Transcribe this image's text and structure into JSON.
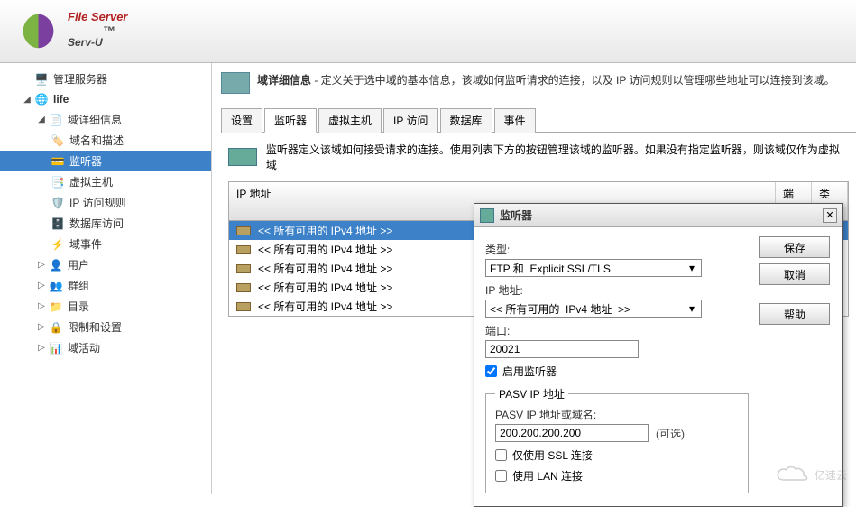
{
  "brand": {
    "top": "File Server",
    "name": "Serv-U",
    "trademark": "™"
  },
  "sidebar": {
    "manage_server": "管理服务器",
    "domain": "life",
    "detail_group": "域详细信息",
    "items": {
      "domain_desc": "域名和描述",
      "listener": "监听器",
      "vhost": "虚拟主机",
      "ip_rules": "IP 访问规则",
      "db_access": "数据库访问",
      "events": "域事件"
    },
    "user": "用户",
    "group": "群组",
    "directory": "目录",
    "restrict": "限制和设置",
    "activity": "域活动"
  },
  "main": {
    "desc_title": "域详细信息",
    "desc_body": " - 定义关于选中域的基本信息，该域如何监听请求的连接，以及 IP 访问规则以管理哪些地址可以连接到该域。",
    "tabs": {
      "settings": "设置",
      "listener": "监听器",
      "vhost": "虚拟主机",
      "ip": "IP 访问",
      "db": "数据库",
      "events": "事件"
    },
    "listener_desc": "监听器定义该域如何接受请求的连接。使用列表下方的按钮管理该域的监听器。如果没有指定监听器，则该域仅作为虚拟域",
    "grid": {
      "col_ip": "IP 地址",
      "col_port": "端口",
      "col_type": "类型",
      "rows": [
        "<< 所有可用的 IPv4 地址 >>",
        "<< 所有可用的 IPv4 地址 >>",
        "<< 所有可用的 IPv4 地址 >>",
        "<< 所有可用的 IPv4 地址 >>",
        "<< 所有可用的 IPv4 地址 >>"
      ]
    }
  },
  "dialog": {
    "title": "监听器",
    "type_label": "类型:",
    "type_value": "FTP 和  Explicit SSL/TLS",
    "ip_label": "IP 地址:",
    "ip_value": "<< 所有可用的  IPv4 地址  >>",
    "port_label": "端口:",
    "port_value": "20021",
    "enable_label": "启用监听器",
    "enable_checked": true,
    "pasv_legend": "PASV IP 地址",
    "pasv_label": "PASV IP 地址或域名:",
    "pasv_value": "200.200.200.200",
    "pasv_opt": "(可选)",
    "ssl_only_label": "仅使用 SSL 连接",
    "lan_label": "使用 LAN 连接",
    "buttons": {
      "save": "保存",
      "cancel": "取消",
      "help": "帮助"
    }
  },
  "watermark": "亿速云"
}
